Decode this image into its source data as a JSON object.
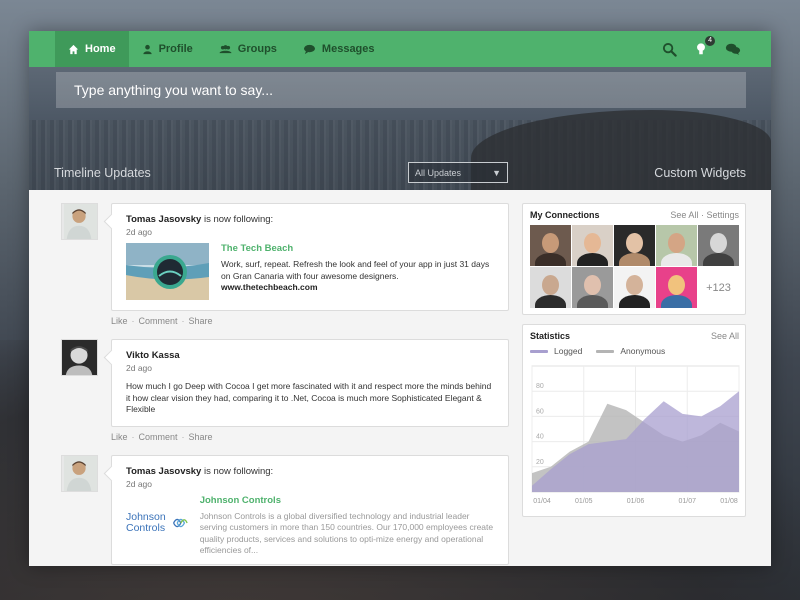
{
  "nav": {
    "items": [
      {
        "label": "Home",
        "icon": "home-icon",
        "active": true
      },
      {
        "label": "Profile",
        "icon": "user-icon",
        "active": false
      },
      {
        "label": "Groups",
        "icon": "group-icon",
        "active": false
      },
      {
        "label": "Messages",
        "icon": "chat-icon",
        "active": false
      }
    ],
    "notifications_count": "4"
  },
  "hero": {
    "placeholder": "Type anything you want to say...",
    "left_label": "Timeline Updates",
    "right_label": "Custom Widgets",
    "filter_value": "All Updates"
  },
  "feed": [
    {
      "name": "Tomas Jasovsky",
      "action": " is now following:",
      "time": "2d ago",
      "share_title": "The Tech Beach",
      "share_desc": "Work, surf, repeat. Refresh the look and feel of your app in just 31 days on Gran Canaria with four awesome designers.",
      "share_link": "www.thetechbeach.com"
    },
    {
      "name": "Vikto Kassa",
      "time": "2d ago",
      "text": "How much I go Deep with Cocoa I get more fascinated with it and respect  more the minds behind it how clear vision they had, comparing it to .Net, Cocoa is much more Sophisticated Elegant & Flexible"
    },
    {
      "name": "Tomas Jasovsky",
      "action": " is now following:",
      "time": "2d ago",
      "share_title": "Johnson Controls",
      "logo_text_1": "Johnson",
      "logo_text_2": "Controls",
      "share_desc": "Johnson Controls is a global diversified technology and industrial leader serving customers in more than 150 countries. Our 170,000 employees create quality products, services and solutions to opti-mize energy and operational efficiencies of..."
    }
  ],
  "actions": {
    "like": "Like",
    "comment": "Comment",
    "share": "Share",
    "sep": "·"
  },
  "connections": {
    "title": "My Connections",
    "see_all": "See All",
    "settings": "Settings",
    "sep": "·",
    "more": "+123"
  },
  "statistics": {
    "title": "Statistics",
    "see_all": "See All",
    "legend_logged": "Logged",
    "legend_anonymous": "Anonymous"
  },
  "colors": {
    "accent": "#4fb26d",
    "logged": "#a89fcf",
    "anonymous": "#b4b4b4"
  },
  "chart_data": {
    "type": "area",
    "x": [
      "01/04",
      "01/05",
      "01/06",
      "01/07",
      "01/08"
    ],
    "ylim": [
      0,
      100
    ],
    "yticks": [
      "20",
      "40",
      "60",
      "80"
    ],
    "series": [
      {
        "name": "Logged",
        "values": [
          5,
          18,
          30,
          38,
          40,
          42,
          58,
          72,
          62,
          60,
          68,
          80
        ]
      },
      {
        "name": "Anonymous",
        "values": [
          15,
          20,
          32,
          40,
          70,
          65,
          55,
          45,
          40,
          45,
          55,
          48
        ]
      }
    ]
  }
}
